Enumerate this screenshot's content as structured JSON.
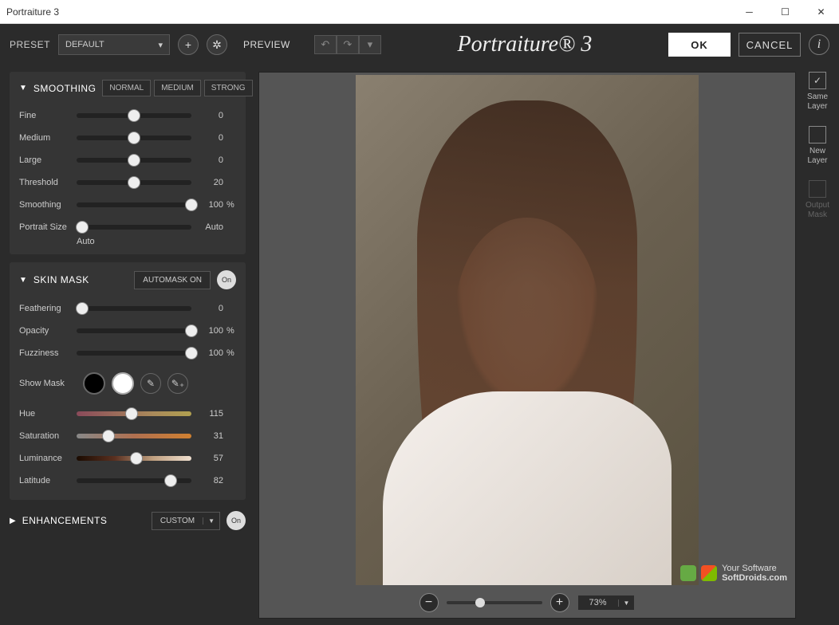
{
  "window": {
    "title": "Portraiture 3"
  },
  "topbar": {
    "preset_label": "PRESET",
    "preset_value": "DEFAULT",
    "preview_label": "PREVIEW",
    "brand": "Portraiture® 3",
    "ok": "OK",
    "cancel": "CANCEL"
  },
  "smoothing": {
    "title": "SMOOTHING",
    "levels": [
      "NORMAL",
      "MEDIUM",
      "STRONG"
    ],
    "sliders": [
      {
        "label": "Fine",
        "value": 0,
        "pos": 50,
        "unit": ""
      },
      {
        "label": "Medium",
        "value": 0,
        "pos": 50,
        "unit": ""
      },
      {
        "label": "Large",
        "value": 0,
        "pos": 50,
        "unit": ""
      },
      {
        "label": "Threshold",
        "value": 20,
        "pos": 50,
        "unit": ""
      },
      {
        "label": "Smoothing",
        "value": 100,
        "pos": 100,
        "unit": "%"
      },
      {
        "label": "Portrait Size",
        "value": "Auto",
        "pos": 5,
        "unit": ""
      }
    ],
    "size_note": "Auto"
  },
  "skinmask": {
    "title": "SKIN MASK",
    "automask": "AUTOMASK ON",
    "on": "On",
    "sliders1": [
      {
        "label": "Feathering",
        "value": 0,
        "pos": 5,
        "unit": ""
      },
      {
        "label": "Opacity",
        "value": 100,
        "pos": 100,
        "unit": "%"
      },
      {
        "label": "Fuzziness",
        "value": 100,
        "pos": 100,
        "unit": "%"
      }
    ],
    "show_mask": "Show Mask",
    "sliders2": [
      {
        "label": "Hue",
        "value": 115,
        "pos": 48,
        "track": "hue"
      },
      {
        "label": "Saturation",
        "value": 31,
        "pos": 28,
        "track": "sat"
      },
      {
        "label": "Luminance",
        "value": 57,
        "pos": 52,
        "track": "lum"
      },
      {
        "label": "Latitude",
        "value": 82,
        "pos": 82,
        "track": ""
      }
    ]
  },
  "enhancements": {
    "title": "ENHANCEMENTS",
    "mode": "CUSTOM",
    "on": "On"
  },
  "zoom": {
    "percent": "73%",
    "pos": 30
  },
  "rightpanel": {
    "same_layer": "Same Layer",
    "new_layer": "New Layer",
    "output_mask": "Output Mask"
  },
  "watermark": {
    "line1": "Your Software",
    "line2": "SoftDroids.com"
  }
}
